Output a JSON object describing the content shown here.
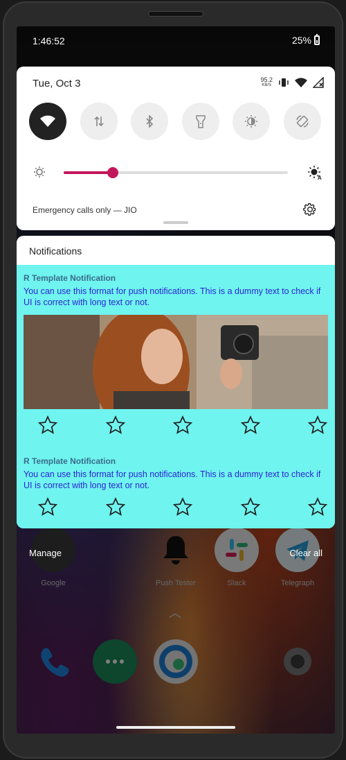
{
  "status_bar": {
    "time": "1:46:52",
    "battery": "25%"
  },
  "quick_settings": {
    "date": "Tue, Oct 3",
    "net_speed_value": "95.2",
    "net_speed_unit": "KB/S",
    "brightness_level": 0.22,
    "footer_text": "Emergency calls only — JIO",
    "tiles": [
      {
        "name": "wifi",
        "active": true
      },
      {
        "name": "mobile-data",
        "active": false
      },
      {
        "name": "bluetooth",
        "active": false
      },
      {
        "name": "flashlight",
        "active": false
      },
      {
        "name": "night-light",
        "active": false
      },
      {
        "name": "auto-rotate",
        "active": false
      }
    ]
  },
  "notifications": {
    "header": "Notifications",
    "items": [
      {
        "title": "R Template Notification",
        "text": "You can use this format for push notifications. This is a dummy text to check if UI is correct with long text or not."
      },
      {
        "title": "R Template Notification",
        "text": "You can use this format for push notifications. This is a dummy text to check if UI is correct with long text or not."
      }
    ]
  },
  "actions": {
    "manage": "Manage",
    "clear_all": "Clear all"
  },
  "home_apps": [
    {
      "label": "Google"
    },
    {
      "label": "Push Tester"
    },
    {
      "label": "Slack"
    },
    {
      "label": "Telegraph"
    }
  ],
  "colors": {
    "accent": "#c2185b",
    "notification_bg": "#6ff4ef",
    "notification_text": "#2c23d8"
  }
}
